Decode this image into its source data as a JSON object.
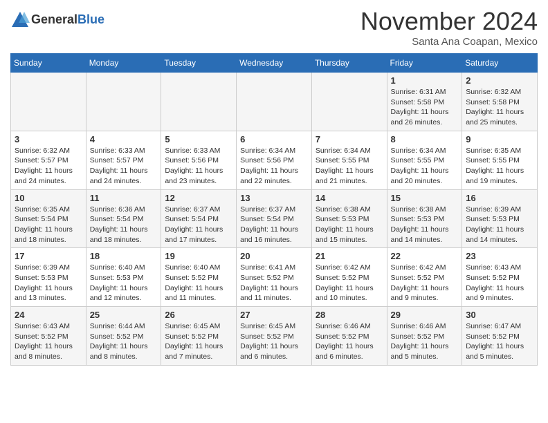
{
  "header": {
    "logo_line1": "General",
    "logo_line2": "Blue",
    "month_title": "November 2024",
    "subtitle": "Santa Ana Coapan, Mexico"
  },
  "days_of_week": [
    "Sunday",
    "Monday",
    "Tuesday",
    "Wednesday",
    "Thursday",
    "Friday",
    "Saturday"
  ],
  "weeks": [
    [
      {
        "day": "",
        "info": ""
      },
      {
        "day": "",
        "info": ""
      },
      {
        "day": "",
        "info": ""
      },
      {
        "day": "",
        "info": ""
      },
      {
        "day": "",
        "info": ""
      },
      {
        "day": "1",
        "info": "Sunrise: 6:31 AM\nSunset: 5:58 PM\nDaylight: 11 hours and 26 minutes."
      },
      {
        "day": "2",
        "info": "Sunrise: 6:32 AM\nSunset: 5:58 PM\nDaylight: 11 hours and 25 minutes."
      }
    ],
    [
      {
        "day": "3",
        "info": "Sunrise: 6:32 AM\nSunset: 5:57 PM\nDaylight: 11 hours and 24 minutes."
      },
      {
        "day": "4",
        "info": "Sunrise: 6:33 AM\nSunset: 5:57 PM\nDaylight: 11 hours and 24 minutes."
      },
      {
        "day": "5",
        "info": "Sunrise: 6:33 AM\nSunset: 5:56 PM\nDaylight: 11 hours and 23 minutes."
      },
      {
        "day": "6",
        "info": "Sunrise: 6:34 AM\nSunset: 5:56 PM\nDaylight: 11 hours and 22 minutes."
      },
      {
        "day": "7",
        "info": "Sunrise: 6:34 AM\nSunset: 5:55 PM\nDaylight: 11 hours and 21 minutes."
      },
      {
        "day": "8",
        "info": "Sunrise: 6:34 AM\nSunset: 5:55 PM\nDaylight: 11 hours and 20 minutes."
      },
      {
        "day": "9",
        "info": "Sunrise: 6:35 AM\nSunset: 5:55 PM\nDaylight: 11 hours and 19 minutes."
      }
    ],
    [
      {
        "day": "10",
        "info": "Sunrise: 6:35 AM\nSunset: 5:54 PM\nDaylight: 11 hours and 18 minutes."
      },
      {
        "day": "11",
        "info": "Sunrise: 6:36 AM\nSunset: 5:54 PM\nDaylight: 11 hours and 18 minutes."
      },
      {
        "day": "12",
        "info": "Sunrise: 6:37 AM\nSunset: 5:54 PM\nDaylight: 11 hours and 17 minutes."
      },
      {
        "day": "13",
        "info": "Sunrise: 6:37 AM\nSunset: 5:54 PM\nDaylight: 11 hours and 16 minutes."
      },
      {
        "day": "14",
        "info": "Sunrise: 6:38 AM\nSunset: 5:53 PM\nDaylight: 11 hours and 15 minutes."
      },
      {
        "day": "15",
        "info": "Sunrise: 6:38 AM\nSunset: 5:53 PM\nDaylight: 11 hours and 14 minutes."
      },
      {
        "day": "16",
        "info": "Sunrise: 6:39 AM\nSunset: 5:53 PM\nDaylight: 11 hours and 14 minutes."
      }
    ],
    [
      {
        "day": "17",
        "info": "Sunrise: 6:39 AM\nSunset: 5:53 PM\nDaylight: 11 hours and 13 minutes."
      },
      {
        "day": "18",
        "info": "Sunrise: 6:40 AM\nSunset: 5:53 PM\nDaylight: 11 hours and 12 minutes."
      },
      {
        "day": "19",
        "info": "Sunrise: 6:40 AM\nSunset: 5:52 PM\nDaylight: 11 hours and 11 minutes."
      },
      {
        "day": "20",
        "info": "Sunrise: 6:41 AM\nSunset: 5:52 PM\nDaylight: 11 hours and 11 minutes."
      },
      {
        "day": "21",
        "info": "Sunrise: 6:42 AM\nSunset: 5:52 PM\nDaylight: 11 hours and 10 minutes."
      },
      {
        "day": "22",
        "info": "Sunrise: 6:42 AM\nSunset: 5:52 PM\nDaylight: 11 hours and 9 minutes."
      },
      {
        "day": "23",
        "info": "Sunrise: 6:43 AM\nSunset: 5:52 PM\nDaylight: 11 hours and 9 minutes."
      }
    ],
    [
      {
        "day": "24",
        "info": "Sunrise: 6:43 AM\nSunset: 5:52 PM\nDaylight: 11 hours and 8 minutes."
      },
      {
        "day": "25",
        "info": "Sunrise: 6:44 AM\nSunset: 5:52 PM\nDaylight: 11 hours and 8 minutes."
      },
      {
        "day": "26",
        "info": "Sunrise: 6:45 AM\nSunset: 5:52 PM\nDaylight: 11 hours and 7 minutes."
      },
      {
        "day": "27",
        "info": "Sunrise: 6:45 AM\nSunset: 5:52 PM\nDaylight: 11 hours and 6 minutes."
      },
      {
        "day": "28",
        "info": "Sunrise: 6:46 AM\nSunset: 5:52 PM\nDaylight: 11 hours and 6 minutes."
      },
      {
        "day": "29",
        "info": "Sunrise: 6:46 AM\nSunset: 5:52 PM\nDaylight: 11 hours and 5 minutes."
      },
      {
        "day": "30",
        "info": "Sunrise: 6:47 AM\nSunset: 5:52 PM\nDaylight: 11 hours and 5 minutes."
      }
    ]
  ]
}
